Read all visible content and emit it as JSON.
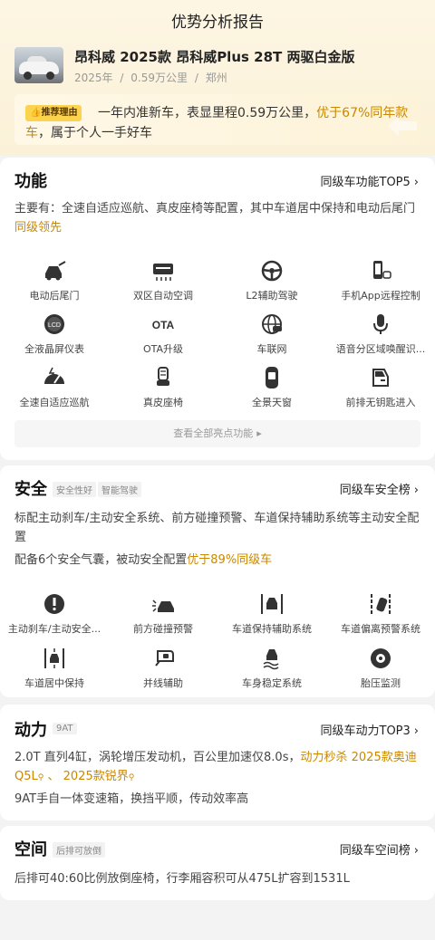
{
  "page_title": "优势分析报告",
  "car": {
    "name": "昂科威 2025款 昂科威Plus 28T 两驱白金版",
    "year": "2025年",
    "mileage": "0.59万公里",
    "city": "郑州",
    "sep": "/"
  },
  "reco": {
    "badge": "推荐理由",
    "text_a": "一年内准新车，表显里程0.59万公里，",
    "text_hl": "优于67%同年款车",
    "text_b": "，属于个人一手好车"
  },
  "function_section": {
    "title": "功能",
    "link": "同级车功能TOP5",
    "desc_a": "主要有：全速自适应巡航、真皮座椅等配置，其中车道居中保持和电动后尾门",
    "desc_hl": "同级领先",
    "features": [
      {
        "label": "电动后尾门",
        "icon": "tailgate-icon"
      },
      {
        "label": "双区自动空调",
        "icon": "ac-icon"
      },
      {
        "label": "L2辅助驾驶",
        "icon": "steering-wheel-icon"
      },
      {
        "label": "手机App远程控制",
        "icon": "phone-car-icon"
      },
      {
        "label": "全液晶屏仪表",
        "icon": "lcd-gauge-icon"
      },
      {
        "label": "OTA升级",
        "icon": "ota-icon"
      },
      {
        "label": "车联网",
        "icon": "car-network-icon"
      },
      {
        "label": "语音分区域唤醒识...",
        "icon": "microphone-icon"
      },
      {
        "label": "全速自适应巡航",
        "icon": "cruise-icon"
      },
      {
        "label": "真皮座椅",
        "icon": "seat-icon"
      },
      {
        "label": "全景天窗",
        "icon": "sunroof-icon"
      },
      {
        "label": "前排无钥匙进入",
        "icon": "keyless-door-icon"
      }
    ],
    "ota_text": "OTA",
    "lcd_text": "LCD",
    "see_all": "查看全部亮点功能"
  },
  "safety_section": {
    "title": "安全",
    "tags": [
      "安全性好",
      "智能驾驶"
    ],
    "link": "同级车安全榜",
    "desc1": "标配主动刹车/主动安全系统、前方碰撞预警、车道保持辅助系统等主动安全配置",
    "desc2_a": "配备6个安全气囊，被动安全配置",
    "desc2_hl": "优于89%同级车",
    "features": [
      {
        "label": "主动刹车/主动安全...",
        "icon": "brake-icon"
      },
      {
        "label": "前方碰撞预警",
        "icon": "collision-warning-icon"
      },
      {
        "label": "车道保持辅助系统",
        "icon": "lane-keep-icon"
      },
      {
        "label": "车道偏离预警系统",
        "icon": "lane-departure-icon"
      },
      {
        "label": "车道居中保持",
        "icon": "lane-center-icon"
      },
      {
        "label": "并线辅助",
        "icon": "blind-spot-icon"
      },
      {
        "label": "车身稳定系统",
        "icon": "stability-icon"
      },
      {
        "label": "胎压监测",
        "icon": "tire-pressure-icon"
      }
    ]
  },
  "power_section": {
    "title": "动力",
    "tag": "9AT",
    "link": "同级车动力TOP3",
    "desc1_a": "2.0T 直列4缸，涡轮增压发动机，百公里加速仅8.0s，",
    "desc1_hl": "动力秒杀",
    "desc1_link1": "2025款奥迪Q5L",
    "desc1_sep": "、",
    "desc1_link2": "2025款锐界",
    "desc2": "9AT手自一体变速箱，换挡平顺，传动效率高"
  },
  "space_section": {
    "title": "空间",
    "tag": "后排可放倒",
    "link": "同级车空间榜",
    "desc": "后排可40:60比例放倒座椅，行李厢容积可从475L扩容到1531L"
  },
  "colors": {
    "accent": "#c98800",
    "badge_bg": "#fcd34d",
    "hero_bg": "#fdf6e3"
  }
}
